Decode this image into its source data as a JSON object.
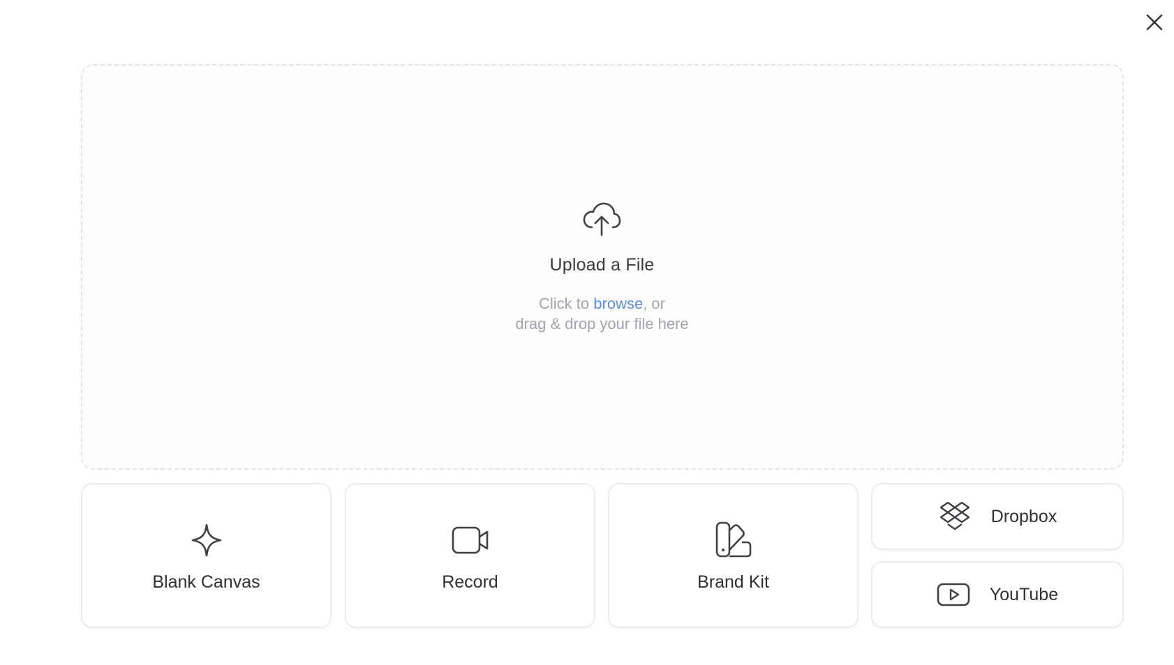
{
  "upload": {
    "title": "Upload a File",
    "subtitle_prefix": "Click to ",
    "browse_label": "browse",
    "subtitle_suffix": ", or",
    "subtitle_line2": "drag & drop your file here"
  },
  "options": {
    "blank_canvas": "Blank Canvas",
    "record": "Record",
    "brand_kit": "Brand Kit",
    "dropbox": "Dropbox",
    "youtube": "YouTube"
  },
  "icons": {
    "close": "close-icon",
    "upload": "cloud-upload-icon",
    "blank_canvas": "sparkle-icon",
    "record": "video-camera-icon",
    "brand_kit": "swatch-book-icon",
    "dropbox": "dropbox-icon",
    "youtube": "youtube-icon"
  },
  "colors": {
    "link": "#5b8fd6",
    "text": "#2f2f34",
    "muted": "#a3a3ab"
  }
}
